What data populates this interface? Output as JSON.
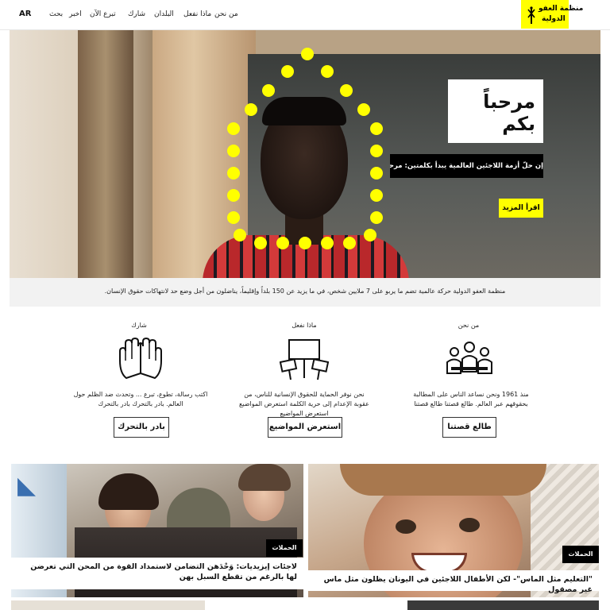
{
  "header": {
    "lang": "AR",
    "nav": [
      "بحث",
      "اخبر",
      "تبرع الآن",
      "شارك",
      "البلدان",
      "ماذا نفعل",
      "من نحن"
    ],
    "logo_line1": "منظمة العفو",
    "logo_line2": "الدولية"
  },
  "hero": {
    "welcome": "مرحباً بكم",
    "tagline": "إن حلّ أزمة اللاجئين العالمية يبدأ بكلمتين: مرحباً بكم",
    "read_more": "اقرأ المزيد"
  },
  "intro": {
    "text": "منظمة العفو الدولية حركة عالمية تضم ما يربو على 7 ملايين شخص، في ما يزيد عن 150 بلداً وإقليماً، يناضلون من أجل وضع حد لانتهاكات حقوق الإنسان."
  },
  "columns": [
    {
      "title": "من نحن",
      "icon": "people-group-icon",
      "desc": "منذ 1961 ونحن نساعد الناس على المطالبة بحقوقهم عبر العالم. طالع قصتنا طالع قصتنا",
      "button": "طالع قصتنا"
    },
    {
      "title": "ماذا نفعل",
      "icon": "protest-signs-icon",
      "desc": "نحن نوفر الحماية للحقوق الإنسانية للناس، من عقوبة الإعدام إلى حرية الكلمة استعرض المواضيع استعرض المواضيع",
      "button": "استعرض المواضيع"
    },
    {
      "title": "شارك",
      "icon": "raised-hands-icon",
      "desc": "اكتب رسالة، تطوع، تبرع ... وتحدث ضد الظلم حول العالم. بادر بالتحرك بادر بالتحرك",
      "button": "بادر بالتحرك"
    }
  ],
  "cards": [
    {
      "badge": "الحملات",
      "caption": "لاجئات إيزيديات: وَحْدَهن التضامن لاستمداد القوة من المحن التي تعرضن لها بالرغم من تقطع السبل بهن"
    },
    {
      "badge": "الحملات",
      "caption": "\"التعليم مثل الماس\"- لكن الأطفال اللاجئين في اليونان يظلون مثل ماس غير مصقول"
    }
  ],
  "colors": {
    "brand_yellow": "#ffff00",
    "black": "#000000"
  }
}
